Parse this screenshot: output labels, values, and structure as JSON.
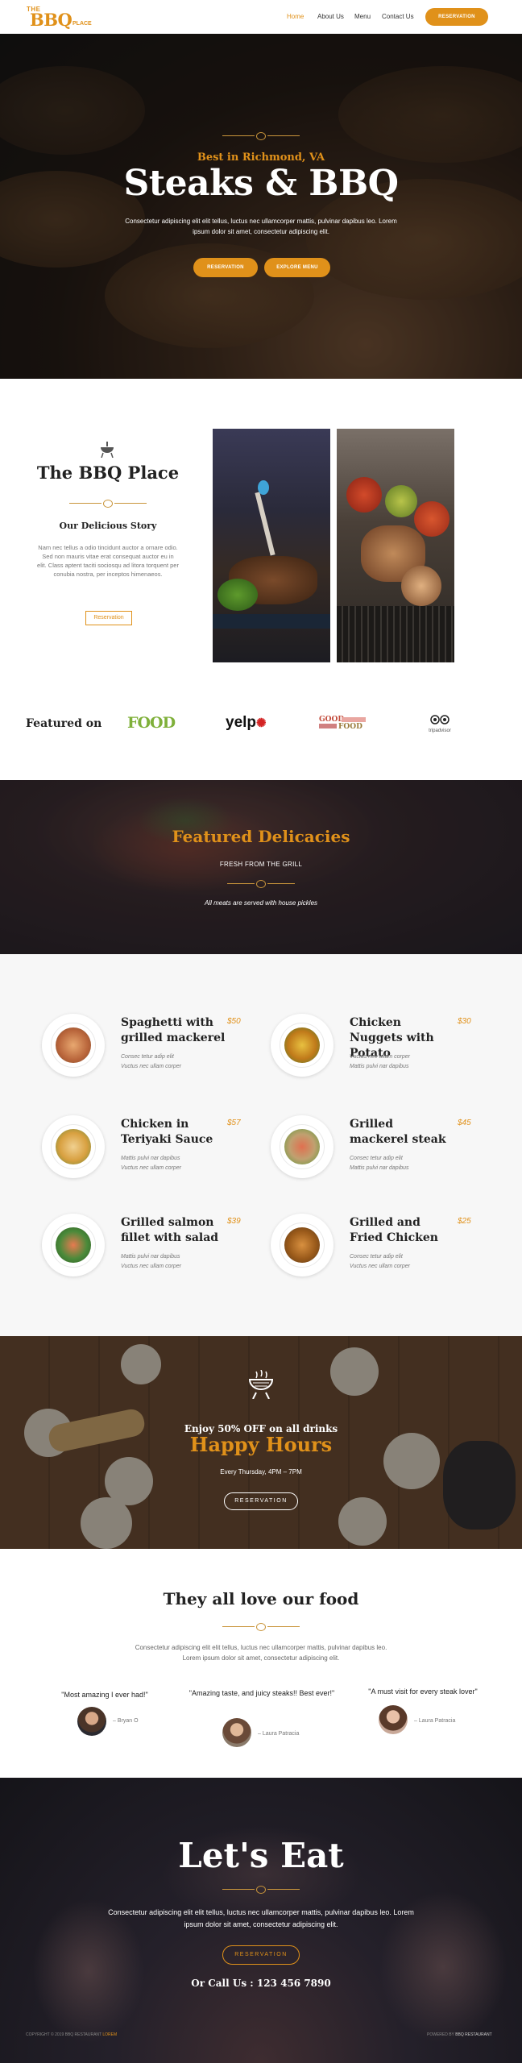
{
  "header": {
    "logo": {
      "the": "THE",
      "bbq": "BBQ",
      "place": "PLACE"
    },
    "nav": [
      {
        "label": "Home",
        "active": true
      },
      {
        "label": "About Us",
        "active": false
      },
      {
        "label": "Menu",
        "active": false
      },
      {
        "label": "Contact Us",
        "active": false
      }
    ],
    "cta": "RESERVATION"
  },
  "hero": {
    "kicker": "Best in Richmond, VA",
    "title": "Steaks & BBQ",
    "text": "Consectetur adipiscing elit elit tellus, luctus nec ullamcorper mattis, pulvinar dapibus leo. Lorem ipsum dolor sit amet, consectetur adipiscing elit.",
    "btn_reserve": "RESERVATION",
    "btn_menu": "EXPLORE MENU"
  },
  "about": {
    "title": "The BBQ Place",
    "subtitle": "Our Delicious Story",
    "text": "Nam nec tellus a odio tincidunt auctor a ornare odio. Sed non mauris vitae erat consequat auctor eu in elit. Class aptent taciti sociosqu ad litora torquent per conubia nostra, per inceptos himenaeos.",
    "btn": "Reservation"
  },
  "featured_on": {
    "label": "Featured on",
    "logos": {
      "food": "FOOD",
      "yelp": "yelp",
      "good_food_1": "GOOD",
      "good_food_2": "FOOD",
      "tripadvisor": "tripadvisor"
    }
  },
  "delicacies": {
    "title": "Featured Delicacies",
    "subtitle": "FRESH FROM THE GRILL",
    "note": "All meats are served with house pickles"
  },
  "menu": [
    {
      "name": "Spaghetti with grilled mackerel",
      "price": "$50",
      "desc1": "Consec tetur adip elit",
      "desc2": "Vuctus nec ullam corper"
    },
    {
      "name": "Chicken Nuggets with Potato",
      "price": "$30",
      "desc1": "Vuctus nec ullam corper",
      "desc2": "Mattis pulvi nar dapibus"
    },
    {
      "name": "Chicken in Teriyaki Sauce",
      "price": "$57",
      "desc1": "Mattis pulvi nar dapibus",
      "desc2": "Vuctus nec ullam corper"
    },
    {
      "name": "Grilled mackerel steak",
      "price": "$45",
      "desc1": "Consec tetur adip elit",
      "desc2": "Mattis pulvi nar dapibus"
    },
    {
      "name": "Grilled salmon fillet with salad",
      "price": "$39",
      "desc1": "Mattis pulvi nar dapibus",
      "desc2": "Vuctus nec ullam corper"
    },
    {
      "name": "Grilled and Fried Chicken",
      "price": "$25",
      "desc1": "Consec tetur adip elit",
      "desc2": "Vuctus nec ullam corper"
    }
  ],
  "happy": {
    "kicker": "Enjoy 50% OFF on all drinks",
    "title": "Happy Hours",
    "time": "Every Thursday, 4PM – 7PM",
    "btn": "RESERVATION"
  },
  "testimonials": {
    "title": "They all love our food",
    "text": "Consectetur adipiscing elit elit tellus, luctus nec ullamcorper mattis, pulvinar dapibus leo. Lorem ipsum dolor sit amet, consectetur adipiscing elit.",
    "items": [
      {
        "quote": "\"Most amazing I ever had!\"",
        "author": "– Bryan O"
      },
      {
        "quote": "\"Amazing taste, and juicy steaks!! Best ever!\"",
        "author": "– Laura Patracia"
      },
      {
        "quote": "\"A must visit for every steak lover\"",
        "author": "– Laura Patracia"
      }
    ]
  },
  "eat": {
    "title": "Let's Eat",
    "text": "Consectetur adipiscing elit elit tellus, luctus nec ullamcorper mattis, pulvinar dapibus leo. Lorem ipsum dolor sit amet, consectetur adipiscing elit.",
    "btn": "RESERVATION",
    "call": "Or Call Us : 123 456 7890"
  },
  "footer": {
    "left": "COPYRIGHT © 2019 BBQ RESTAURANT",
    "left_link": "LOREM",
    "right": "POWERED BY",
    "right_link": "BBQ RESTAURANT"
  },
  "colors": {
    "accent": "#e0911a",
    "dark": "#222222"
  }
}
